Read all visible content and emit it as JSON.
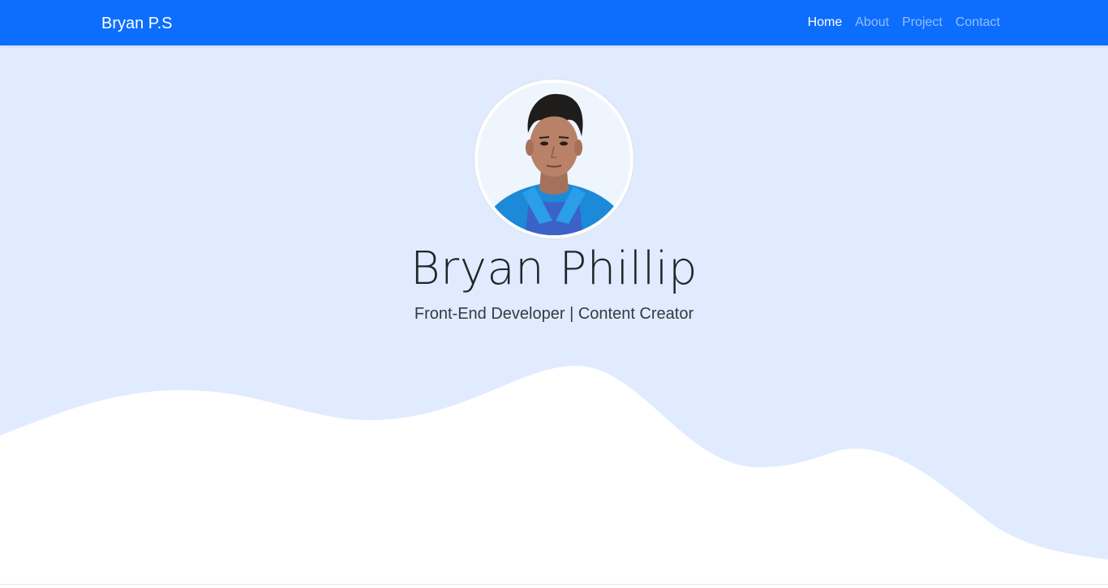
{
  "navbar": {
    "brand": "Bryan P.S",
    "links": [
      {
        "label": "Home",
        "active": true
      },
      {
        "label": "About",
        "active": false
      },
      {
        "label": "Project",
        "active": false
      },
      {
        "label": "Contact",
        "active": false
      }
    ]
  },
  "hero": {
    "avatar_alt": "profile-photo",
    "name": "Bryan Phillip",
    "tagline": "Front-End Developer | Content Creator"
  },
  "colors": {
    "navbar_bg": "#0d6efd",
    "hero_bg": "#e0ebff",
    "wave_fill": "#ffffff"
  }
}
